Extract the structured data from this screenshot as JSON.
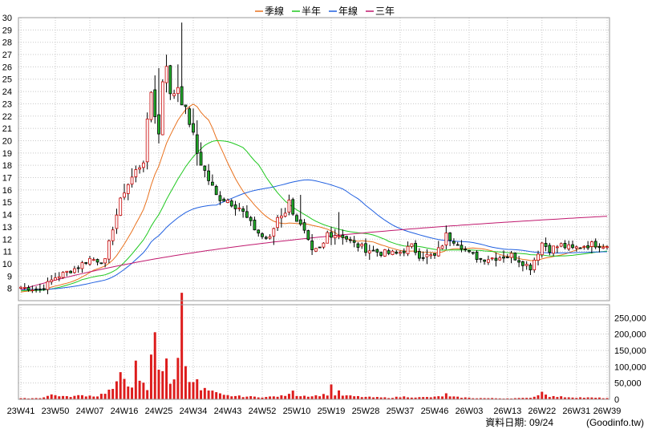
{
  "chart_data": {
    "type": "candlestick",
    "legend": [
      {
        "name": "季線",
        "color": "#e8701c"
      },
      {
        "name": "半年",
        "color": "#1fc81f"
      },
      {
        "name": "年線",
        "color": "#1f5fe0"
      },
      {
        "name": "三年",
        "color": "#c0196e"
      }
    ],
    "price_axis": {
      "ylim": [
        7,
        30
      ],
      "ticks": [
        "8",
        "9",
        "10",
        "11",
        "12",
        "13",
        "14",
        "15",
        "16",
        "17",
        "18",
        "19",
        "20",
        "21",
        "22",
        "23",
        "24",
        "25",
        "26",
        "27",
        "28",
        "29",
        "30"
      ]
    },
    "volume_axis": {
      "ylim": [
        0,
        290000
      ],
      "ticks": [
        "0",
        "50,000",
        "100,000",
        "150,000",
        "200,000",
        "250,000"
      ]
    },
    "x_ticks": [
      "23W41",
      "23W50",
      "24W07",
      "24W16",
      "24W25",
      "24W34",
      "24W43",
      "24W52",
      "25W10",
      "25W19",
      "25W28",
      "25W37",
      "25W46",
      "26W03",
      "26W13",
      "26W22",
      "26W31",
      "26W39"
    ],
    "x_tick_week_index": [
      0,
      9,
      18,
      27,
      36,
      45,
      54,
      63,
      72,
      81,
      90,
      99,
      108,
      117,
      127,
      136,
      145,
      153
    ],
    "footer": "資料日期: 09/24",
    "source": "(Goodinfo.tw)",
    "anchors_close": [
      [
        0,
        8.1
      ],
      [
        5,
        7.9
      ],
      [
        9,
        8.9
      ],
      [
        14,
        9.6
      ],
      [
        18,
        10.4
      ],
      [
        22,
        10.2
      ],
      [
        24,
        13.0
      ],
      [
        27,
        16.0
      ],
      [
        30,
        17.5
      ],
      [
        32,
        18.5
      ],
      [
        34,
        24.0
      ],
      [
        36,
        20.5
      ],
      [
        37,
        25.0
      ],
      [
        38,
        26.5
      ],
      [
        39,
        23.5
      ],
      [
        41,
        24.5
      ],
      [
        43,
        22.3
      ],
      [
        44,
        21.6
      ],
      [
        46,
        19.0
      ],
      [
        48,
        17.5
      ],
      [
        51,
        15.5
      ],
      [
        54,
        15.2
      ],
      [
        57,
        14.6
      ],
      [
        60,
        13.2
      ],
      [
        63,
        12.2
      ],
      [
        65,
        12.0
      ],
      [
        67,
        13.8
      ],
      [
        69,
        14.3
      ],
      [
        70,
        15.0
      ],
      [
        72,
        13.6
      ],
      [
        74,
        12.5
      ],
      [
        76,
        10.9
      ],
      [
        78,
        11.2
      ],
      [
        79,
        11.6
      ],
      [
        80,
        12.5
      ],
      [
        82,
        12.4
      ],
      [
        84,
        12.3
      ],
      [
        87,
        11.6
      ],
      [
        90,
        11.2
      ],
      [
        94,
        10.9
      ],
      [
        98,
        10.8
      ],
      [
        102,
        11.4
      ],
      [
        104,
        10.7
      ],
      [
        108,
        10.6
      ],
      [
        110,
        11.6
      ],
      [
        111,
        12.3
      ],
      [
        112,
        12.1
      ],
      [
        114,
        11.8
      ],
      [
        117,
        10.8
      ],
      [
        120,
        10.4
      ],
      [
        124,
        10.5
      ],
      [
        128,
        10.7
      ],
      [
        131,
        10.1
      ],
      [
        133,
        9.7
      ],
      [
        135,
        11.0
      ],
      [
        136,
        11.7
      ],
      [
        138,
        11.2
      ],
      [
        141,
        11.5
      ],
      [
        144,
        11.2
      ],
      [
        147,
        11.5
      ],
      [
        150,
        11.6
      ],
      [
        153,
        11.5
      ]
    ],
    "anchors_volume": [
      [
        0,
        3000
      ],
      [
        5,
        4000
      ],
      [
        8,
        14000
      ],
      [
        12,
        8000
      ],
      [
        16,
        12000
      ],
      [
        20,
        10000
      ],
      [
        24,
        32000
      ],
      [
        25,
        45000
      ],
      [
        26,
        70000
      ],
      [
        27,
        65000
      ],
      [
        28,
        50000
      ],
      [
        29,
        45000
      ],
      [
        30,
        98000
      ],
      [
        31,
        48000
      ],
      [
        32,
        44000
      ],
      [
        33,
        30000
      ],
      [
        35,
        210000
      ],
      [
        36,
        105000
      ],
      [
        37,
        100000
      ],
      [
        38,
        130000
      ],
      [
        39,
        40000
      ],
      [
        40,
        58000
      ],
      [
        41,
        155000
      ],
      [
        42,
        290000
      ],
      [
        43,
        110000
      ],
      [
        44,
        70000
      ],
      [
        45,
        60000
      ],
      [
        46,
        52000
      ],
      [
        47,
        28000
      ],
      [
        48,
        30000
      ],
      [
        50,
        22000
      ],
      [
        53,
        12000
      ],
      [
        56,
        10000
      ],
      [
        60,
        8000
      ],
      [
        64,
        7000
      ],
      [
        68,
        10000
      ],
      [
        70,
        14000
      ],
      [
        71,
        34000
      ],
      [
        72,
        12000
      ],
      [
        76,
        10000
      ],
      [
        80,
        15000
      ],
      [
        81,
        42000
      ],
      [
        82,
        14000
      ],
      [
        83,
        22000
      ],
      [
        84,
        12000
      ],
      [
        86,
        10000
      ],
      [
        90,
        7000
      ],
      [
        96,
        5000
      ],
      [
        100,
        8000
      ],
      [
        104,
        6000
      ],
      [
        108,
        7000
      ],
      [
        110,
        10000
      ],
      [
        111,
        16000
      ],
      [
        112,
        8000
      ],
      [
        118,
        4000
      ],
      [
        126,
        3000
      ],
      [
        132,
        4000
      ],
      [
        134,
        8000
      ],
      [
        136,
        22000
      ],
      [
        137,
        18000
      ],
      [
        138,
        9000
      ],
      [
        145,
        6000
      ],
      [
        153,
        4000
      ]
    ],
    "n_weeks": 154,
    "colors": {
      "up_candle": "#ffffff",
      "down_candle": "#22b02b",
      "candle_stroke": "#c80000",
      "volume": "#dd1c1c",
      "grid": "#c8c8c8",
      "frame": "#9a9a9a"
    }
  }
}
